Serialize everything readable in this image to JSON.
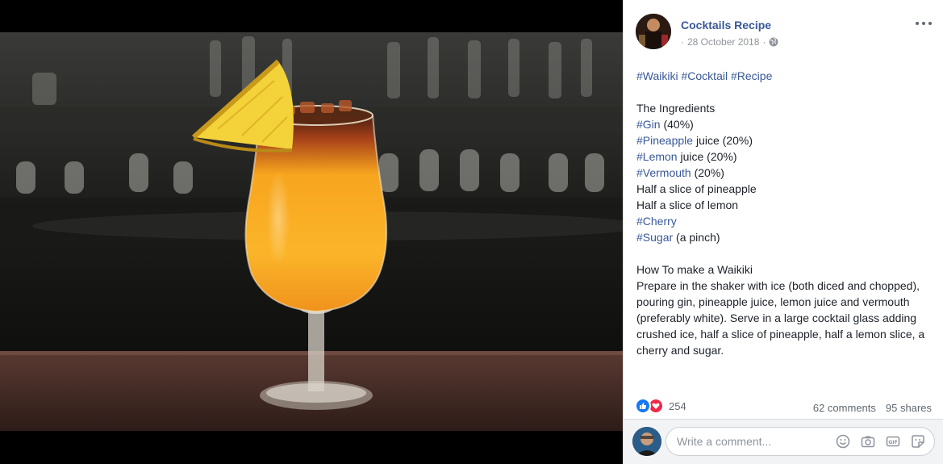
{
  "post": {
    "page_name": "Cocktails Recipe",
    "date": "28 October 2018",
    "separator": "·",
    "hashtags": [
      {
        "text": "#Waikiki"
      },
      {
        "text": "#Cocktail"
      },
      {
        "text": "#Recipe"
      }
    ],
    "ingredients_title": "The Ingredients",
    "ingredients": [
      {
        "tag": "#Gin",
        "rest": " (40%)"
      },
      {
        "tag": "#Pineapple",
        "rest": " juice (20%)"
      },
      {
        "tag": "#Lemon",
        "rest": " juice (20%)"
      },
      {
        "tag": "#Vermouth",
        "rest": " (20%)"
      },
      {
        "tag": "",
        "rest": "Half a slice of pineapple"
      },
      {
        "tag": "",
        "rest": "Half a slice of lemon"
      },
      {
        "tag": "#Cherry",
        "rest": ""
      },
      {
        "tag": "#Sugar",
        "rest": " (a pinch)"
      }
    ],
    "howto_title": "How To make a Waikiki",
    "howto_text": "Prepare in the shaker with ice (both diced and chopped), pouring gin, pineapple juice, lemon juice and vermouth (preferably white). Serve in a large cocktail glass adding crushed ice, half a slice of pineapple, half a lemon slice, a cherry and sugar."
  },
  "stats": {
    "reactions_count": "254",
    "comments": "62 comments",
    "shares": "95 shares"
  },
  "comment": {
    "placeholder": "Write a comment..."
  },
  "icons": {
    "privacy": "globe-icon",
    "more": "more-options-icon",
    "reactions": [
      "like-reaction-icon",
      "love-reaction-icon"
    ],
    "comment_tools": [
      "emoji-icon",
      "camera-icon",
      "gif-icon",
      "sticker-icon"
    ]
  },
  "colors": {
    "link": "#385898",
    "like": "#1877f2",
    "love": "#f0284a"
  }
}
